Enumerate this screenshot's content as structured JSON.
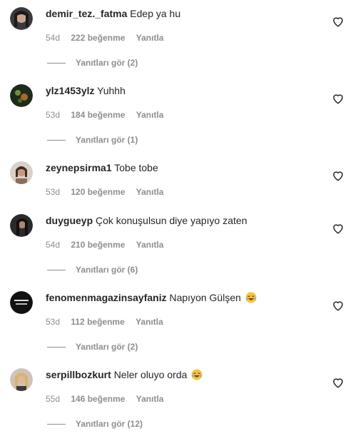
{
  "colors": {
    "text": "#262626",
    "secondary": "#8e8e8e"
  },
  "comments": [
    {
      "username": "demir_tez._fatma",
      "text": "Edep ya hu",
      "emoji": "",
      "age": "54d",
      "likes": "222 beğenme",
      "reply": "Yanıtla",
      "view_replies": "Yanıtları gör (2)"
    },
    {
      "username": "ylz1453ylz",
      "text": "Yuhhh",
      "emoji": "",
      "age": "53d",
      "likes": "184 beğenme",
      "reply": "Yanıtla",
      "view_replies": "Yanıtları gör (1)"
    },
    {
      "username": "zeynepsirma1",
      "text": "Tobe tobe",
      "emoji": "",
      "age": "53d",
      "likes": "120 beğenme",
      "reply": "Yanıtla",
      "view_replies": ""
    },
    {
      "username": "duygueyp",
      "text": "Çok konuşulsun diye yapıyo zaten",
      "emoji": "",
      "age": "54d",
      "likes": "210 beğenme",
      "reply": "Yanıtla",
      "view_replies": "Yanıtları gör (6)"
    },
    {
      "username": "fenomenmagazinsayfaniz",
      "text": "Napıyon Gülşen",
      "emoji": "laughing-tears-emoji",
      "age": "53d",
      "likes": "112 beğenme",
      "reply": "Yanıtla",
      "view_replies": "Yanıtları gör (2)"
    },
    {
      "username": "serpillbozkurt",
      "text": "Neler oluyo orda",
      "emoji": "laughing-tears-emoji",
      "age": "55d",
      "likes": "146 beğenme",
      "reply": "Yanıtla",
      "view_replies": "Yanıtları gör (12)"
    }
  ]
}
